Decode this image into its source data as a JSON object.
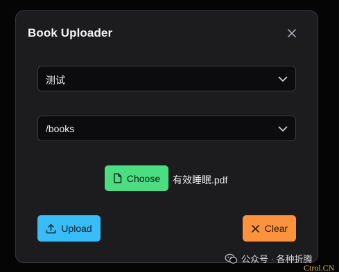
{
  "dialog": {
    "title": "Book Uploader",
    "close_icon": "close-icon"
  },
  "library_select": {
    "selected": "测试",
    "icon": "chevron-down-icon"
  },
  "path_select": {
    "selected": "/books",
    "icon": "chevron-down-icon"
  },
  "file_picker": {
    "choose_label": "Choose",
    "choose_icon": "file-icon",
    "file_name": "有效睡眠.pdf"
  },
  "actions": {
    "upload_label": "Upload",
    "upload_icon": "upload-icon",
    "clear_label": "Clear",
    "clear_icon": "x-icon"
  },
  "watermark": {
    "text": "公众号 · 各种折腾",
    "icon": "wechat-icon",
    "site": "Ctrol.CN"
  },
  "colors": {
    "background": "#050506",
    "dialog": "#1c1c1f",
    "choose": "#4ade80",
    "upload": "#38bdf8",
    "clear": "#fb923c"
  }
}
